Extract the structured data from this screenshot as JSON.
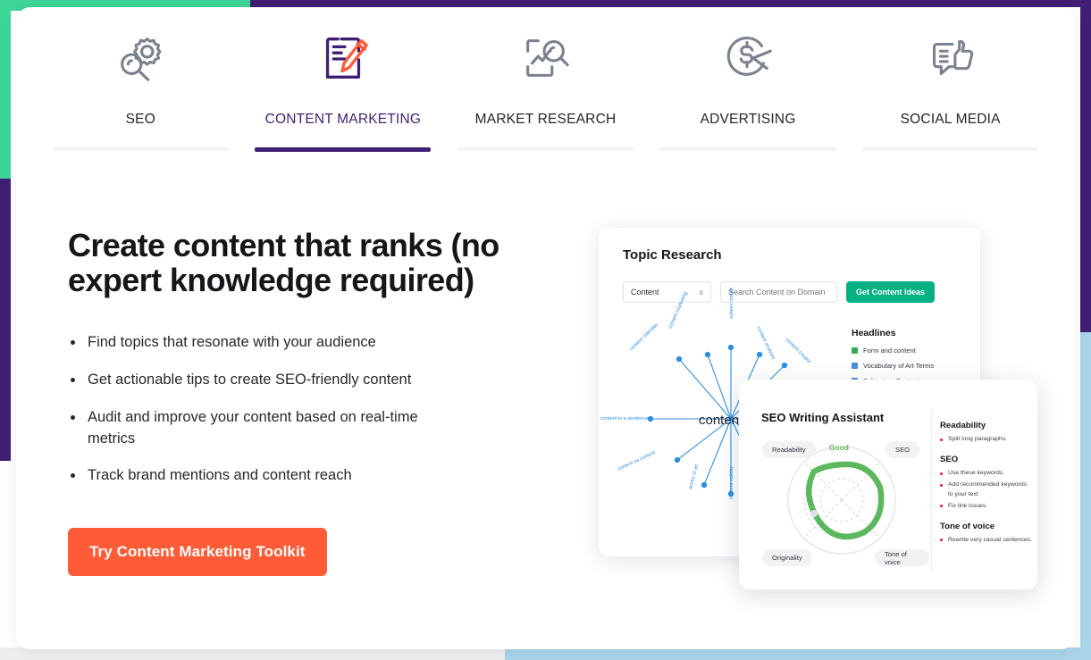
{
  "theme": {
    "accent_purple": "#3f1e73",
    "accent_green": "#3dd598",
    "accent_orange": "#ff5b36",
    "accent_blue": "#a9d4ea",
    "gauge_green": "#5cb85c",
    "bullet_red": "#e8192c",
    "button_green": "#07b183"
  },
  "tabs": [
    {
      "label": "SEO",
      "icon": "seo-gear-magnifier-icon",
      "active": false
    },
    {
      "label": "CONTENT MARKETING",
      "icon": "content-document-pen-icon",
      "active": true
    },
    {
      "label": "MARKET RESEARCH",
      "icon": "chart-magnifier-icon",
      "active": false
    },
    {
      "label": "ADVERTISING",
      "icon": "dollar-target-cursor-icon",
      "active": false
    },
    {
      "label": "SOCIAL MEDIA",
      "icon": "chat-thumbs-up-icon",
      "active": false
    }
  ],
  "hero": {
    "title": "Create content that ranks (no expert knowledge required)",
    "bullets": [
      "Find topics that resonate with your audience",
      "Get actionable tips to create SEO-friendly content",
      "Audit and improve your content based on real-time metrics",
      "Track brand mentions and content reach"
    ],
    "cta_label": "Try Content Marketing Toolkit"
  },
  "topic_research": {
    "title": "Topic Research",
    "keyword_chip": "Content",
    "keyword_clear": "x",
    "domain_placeholder": "Search Content on Domain",
    "submit_label": "Get Content Ideas",
    "mindmap": {
      "center": "content",
      "branches": [
        {
          "label": "content marketing",
          "angle": -68,
          "dist": 95
        },
        {
          "label": "subject matter",
          "angle": -90,
          "dist": 98
        },
        {
          "label": "content analysis",
          "angle": -52,
          "dist": 95
        },
        {
          "label": "content calendar",
          "angle": -110,
          "dist": 100
        },
        {
          "label": "content creator",
          "angle": -32,
          "dist": 104
        },
        {
          "label": "content in a sentence",
          "angle": 180,
          "dist": 108
        },
        {
          "label": "content vs content",
          "angle": 132,
          "dist": 100
        },
        {
          "label": "works of art",
          "angle": 108,
          "dist": 96
        },
        {
          "label": "content validity",
          "angle": 90,
          "dist": 100
        }
      ]
    },
    "headlines": {
      "title": "Headlines",
      "items": [
        {
          "text": "Form and content",
          "mark": "green"
        },
        {
          "text": "Vocabulary of Art Terms",
          "mark": "blue"
        },
        {
          "text": "Subject vs Content",
          "mark": "blue"
        }
      ]
    }
  },
  "seo_writing_assistant": {
    "title": "SEO Writing Assistant",
    "gauge": {
      "status": "Good",
      "axes": [
        "Readability",
        "SEO",
        "Tone of voice",
        "Originality"
      ]
    },
    "recommendations": [
      {
        "heading": "Readability",
        "items": [
          "Split long paragraphs."
        ]
      },
      {
        "heading": "SEO",
        "items": [
          "Use these keywords.",
          "Add recommended keywords to your text",
          "Fix link issues."
        ]
      },
      {
        "heading": "Tone of voice",
        "items": [
          "Rewrite very casual sentences."
        ]
      }
    ]
  }
}
